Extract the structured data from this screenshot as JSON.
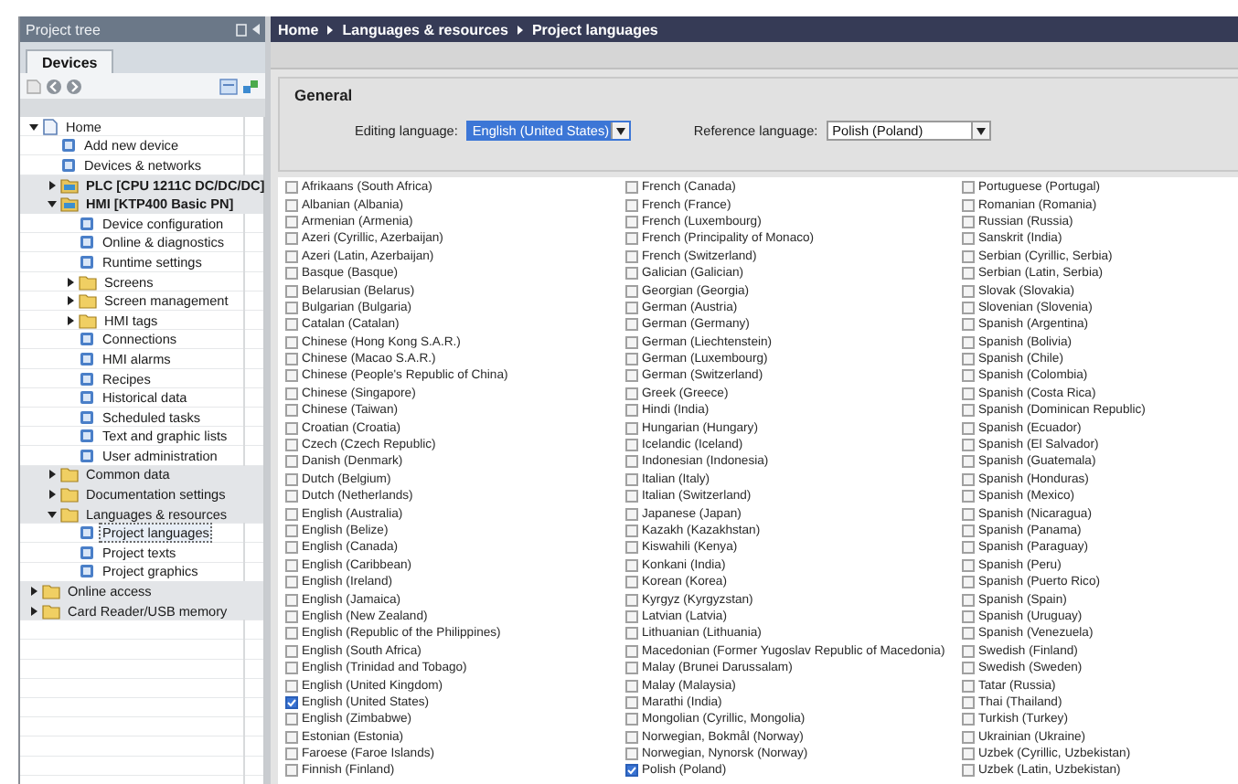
{
  "tree_panel": {
    "title": "Project tree",
    "tabs": [
      {
        "label": "Devices",
        "selected": true
      }
    ]
  },
  "tree": [
    {
      "label": "Home",
      "kind": "home",
      "expanded": true,
      "selected": false,
      "children": [
        {
          "label": "Add new device",
          "kind": "item",
          "selected": false
        },
        {
          "label": "Devices & networks",
          "kind": "item",
          "selected": false
        },
        {
          "label": "PLC [CPU 1211C DC/DC/DC]",
          "kind": "device",
          "expanded": false,
          "selected": false
        },
        {
          "label": "HMI [KTP400 Basic PN]",
          "kind": "device",
          "expanded": true,
          "selected": false,
          "children": [
            {
              "label": "Device configuration",
              "kind": "item",
              "selected": false
            },
            {
              "label": "Online & diagnostics",
              "kind": "item",
              "selected": false
            },
            {
              "label": "Runtime settings",
              "kind": "item",
              "selected": false
            },
            {
              "label": "Screens",
              "kind": "folder",
              "expanded": false,
              "selected": false
            },
            {
              "label": "Screen management",
              "kind": "folder",
              "expanded": false,
              "selected": false
            },
            {
              "label": "HMI tags",
              "kind": "folder",
              "expanded": false,
              "selected": false
            },
            {
              "label": "Connections",
              "kind": "item",
              "selected": false
            },
            {
              "label": "HMI alarms",
              "kind": "item",
              "selected": false
            },
            {
              "label": "Recipes",
              "kind": "item",
              "selected": false
            },
            {
              "label": "Historical data",
              "kind": "item",
              "selected": false
            },
            {
              "label": "Scheduled tasks",
              "kind": "item",
              "selected": false
            },
            {
              "label": "Text and graphic lists",
              "kind": "item",
              "selected": false
            },
            {
              "label": "User administration",
              "kind": "item",
              "selected": false
            }
          ]
        },
        {
          "label": "Common data",
          "kind": "folder",
          "expanded": false,
          "selected": false
        },
        {
          "label": "Documentation settings",
          "kind": "folder",
          "expanded": false,
          "selected": false
        },
        {
          "label": "Languages & resources",
          "kind": "folder",
          "expanded": true,
          "selected": false,
          "children": [
            {
              "label": "Project languages",
              "kind": "item",
              "selected": true
            },
            {
              "label": "Project texts",
              "kind": "item",
              "selected": false
            },
            {
              "label": "Project graphics",
              "kind": "item",
              "selected": false
            }
          ]
        }
      ]
    },
    {
      "label": "Online access",
      "kind": "folder",
      "expanded": false,
      "selected": false
    },
    {
      "label": "Card Reader/USB memory",
      "kind": "folder",
      "expanded": false,
      "selected": false
    }
  ],
  "breadcrumb": [
    "Home",
    "Languages & resources",
    "Project languages"
  ],
  "general": {
    "title": "General",
    "editing_language": {
      "label": "Editing language:",
      "value": "English (United States)",
      "focused": true
    },
    "reference_language": {
      "label": "Reference language:",
      "value": "Polish (Poland)",
      "focused": false
    }
  },
  "language_columns": [
    {
      "items": [
        {
          "label": "Afrikaans (South Africa)",
          "checked": false
        },
        {
          "label": "Albanian (Albania)",
          "checked": false
        },
        {
          "label": "Armenian (Armenia)",
          "checked": false
        },
        {
          "label": "Azeri (Cyrillic, Azerbaijan)",
          "checked": false
        },
        {
          "label": "Azeri (Latin, Azerbaijan)",
          "checked": false
        },
        {
          "label": "Basque (Basque)",
          "checked": false
        },
        {
          "label": "Belarusian (Belarus)",
          "checked": false
        },
        {
          "label": "Bulgarian (Bulgaria)",
          "checked": false
        },
        {
          "label": "Catalan (Catalan)",
          "checked": false
        },
        {
          "label": "Chinese (Hong Kong S.A.R.)",
          "checked": false
        },
        {
          "label": "Chinese (Macao S.A.R.)",
          "checked": false
        },
        {
          "label": "Chinese (People's Republic of China)",
          "checked": false
        },
        {
          "label": "Chinese (Singapore)",
          "checked": false
        },
        {
          "label": "Chinese (Taiwan)",
          "checked": false
        },
        {
          "label": "Croatian (Croatia)",
          "checked": false
        },
        {
          "label": "Czech (Czech Republic)",
          "checked": false
        },
        {
          "label": "Danish (Denmark)",
          "checked": false
        },
        {
          "label": "Dutch (Belgium)",
          "checked": false
        },
        {
          "label": "Dutch (Netherlands)",
          "checked": false
        },
        {
          "label": "English (Australia)",
          "checked": false
        },
        {
          "label": "English (Belize)",
          "checked": false
        },
        {
          "label": "English (Canada)",
          "checked": false
        },
        {
          "label": "English (Caribbean)",
          "checked": false
        },
        {
          "label": "English (Ireland)",
          "checked": false
        },
        {
          "label": "English (Jamaica)",
          "checked": false
        },
        {
          "label": "English (New Zealand)",
          "checked": false
        },
        {
          "label": "English (Republic of the Philippines)",
          "checked": false
        },
        {
          "label": "English (South Africa)",
          "checked": false
        },
        {
          "label": "English (Trinidad and Tobago)",
          "checked": false
        },
        {
          "label": "English (United Kingdom)",
          "checked": false
        },
        {
          "label": "English (United States)",
          "checked": true
        },
        {
          "label": "English (Zimbabwe)",
          "checked": false
        },
        {
          "label": "Estonian (Estonia)",
          "checked": false
        },
        {
          "label": "Faroese (Faroe Islands)",
          "checked": false
        },
        {
          "label": "Finnish (Finland)",
          "checked": false
        }
      ]
    },
    {
      "items": [
        {
          "label": "French (Canada)",
          "checked": false
        },
        {
          "label": "French (France)",
          "checked": false
        },
        {
          "label": "French (Luxembourg)",
          "checked": false
        },
        {
          "label": "French (Principality of Monaco)",
          "checked": false
        },
        {
          "label": "French (Switzerland)",
          "checked": false
        },
        {
          "label": "Galician (Galician)",
          "checked": false
        },
        {
          "label": "Georgian (Georgia)",
          "checked": false
        },
        {
          "label": "German (Austria)",
          "checked": false
        },
        {
          "label": "German (Germany)",
          "checked": false
        },
        {
          "label": "German (Liechtenstein)",
          "checked": false
        },
        {
          "label": "German (Luxembourg)",
          "checked": false
        },
        {
          "label": "German (Switzerland)",
          "checked": false
        },
        {
          "label": "Greek (Greece)",
          "checked": false
        },
        {
          "label": "Hindi (India)",
          "checked": false
        },
        {
          "label": "Hungarian (Hungary)",
          "checked": false
        },
        {
          "label": "Icelandic (Iceland)",
          "checked": false
        },
        {
          "label": "Indonesian (Indonesia)",
          "checked": false
        },
        {
          "label": "Italian (Italy)",
          "checked": false
        },
        {
          "label": "Italian (Switzerland)",
          "checked": false
        },
        {
          "label": "Japanese (Japan)",
          "checked": false
        },
        {
          "label": "Kazakh (Kazakhstan)",
          "checked": false
        },
        {
          "label": "Kiswahili (Kenya)",
          "checked": false
        },
        {
          "label": "Konkani (India)",
          "checked": false
        },
        {
          "label": "Korean (Korea)",
          "checked": false
        },
        {
          "label": "Kyrgyz (Kyrgyzstan)",
          "checked": false
        },
        {
          "label": "Latvian (Latvia)",
          "checked": false
        },
        {
          "label": "Lithuanian (Lithuania)",
          "checked": false
        },
        {
          "label": "Macedonian (Former Yugoslav Republic of Macedonia)",
          "checked": false
        },
        {
          "label": "Malay (Brunei Darussalam)",
          "checked": false
        },
        {
          "label": "Malay (Malaysia)",
          "checked": false
        },
        {
          "label": "Marathi (India)",
          "checked": false
        },
        {
          "label": "Mongolian (Cyrillic, Mongolia)",
          "checked": false
        },
        {
          "label": "Norwegian, Bokmål (Norway)",
          "checked": false
        },
        {
          "label": "Norwegian, Nynorsk (Norway)",
          "checked": false
        },
        {
          "label": "Polish (Poland)",
          "checked": true
        }
      ]
    },
    {
      "items": [
        {
          "label": "Portuguese (Portugal)",
          "checked": false
        },
        {
          "label": "Romanian (Romania)",
          "checked": false
        },
        {
          "label": "Russian (Russia)",
          "checked": false
        },
        {
          "label": "Sanskrit (India)",
          "checked": false
        },
        {
          "label": "Serbian (Cyrillic, Serbia)",
          "checked": false
        },
        {
          "label": "Serbian (Latin, Serbia)",
          "checked": false
        },
        {
          "label": "Slovak (Slovakia)",
          "checked": false
        },
        {
          "label": "Slovenian (Slovenia)",
          "checked": false
        },
        {
          "label": "Spanish (Argentina)",
          "checked": false
        },
        {
          "label": "Spanish (Bolivia)",
          "checked": false
        },
        {
          "label": "Spanish (Chile)",
          "checked": false
        },
        {
          "label": "Spanish (Colombia)",
          "checked": false
        },
        {
          "label": "Spanish (Costa Rica)",
          "checked": false
        },
        {
          "label": "Spanish (Dominican Republic)",
          "checked": false
        },
        {
          "label": "Spanish (Ecuador)",
          "checked": false
        },
        {
          "label": "Spanish (El Salvador)",
          "checked": false
        },
        {
          "label": "Spanish (Guatemala)",
          "checked": false
        },
        {
          "label": "Spanish (Honduras)",
          "checked": false
        },
        {
          "label": "Spanish (Mexico)",
          "checked": false
        },
        {
          "label": "Spanish (Nicaragua)",
          "checked": false
        },
        {
          "label": "Spanish (Panama)",
          "checked": false
        },
        {
          "label": "Spanish (Paraguay)",
          "checked": false
        },
        {
          "label": "Spanish (Peru)",
          "checked": false
        },
        {
          "label": "Spanish (Puerto Rico)",
          "checked": false
        },
        {
          "label": "Spanish (Spain)",
          "checked": false
        },
        {
          "label": "Spanish (Uruguay)",
          "checked": false
        },
        {
          "label": "Spanish (Venezuela)",
          "checked": false
        },
        {
          "label": "Swedish (Finland)",
          "checked": false
        },
        {
          "label": "Swedish (Sweden)",
          "checked": false
        },
        {
          "label": "Tatar (Russia)",
          "checked": false
        },
        {
          "label": "Thai (Thailand)",
          "checked": false
        },
        {
          "label": "Turkish (Turkey)",
          "checked": false
        },
        {
          "label": "Ukrainian (Ukraine)",
          "checked": false
        },
        {
          "label": "Uzbek (Cyrillic, Uzbekistan)",
          "checked": false
        },
        {
          "label": "Uzbek (Latin, Uzbekistan)",
          "checked": false
        }
      ]
    }
  ]
}
